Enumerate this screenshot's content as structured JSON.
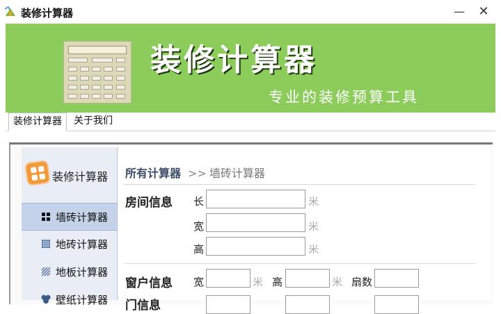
{
  "window": {
    "title": "装修计算器",
    "minimize_glyph": "—",
    "close_glyph": "✕"
  },
  "banner": {
    "title": "装修计算器",
    "subtitle": "专业的装修预算工具",
    "accent_color": "#8ccc5a"
  },
  "tabs": [
    {
      "label": "装修计算器",
      "active": true
    },
    {
      "label": "关于我们",
      "active": false
    }
  ],
  "sidebar": {
    "brand": "装修计算器",
    "items": [
      {
        "label": "墙砖计算器",
        "icon": "grid-icon",
        "selected": true
      },
      {
        "label": "地砖计算器",
        "icon": "checker-icon",
        "selected": false
      },
      {
        "label": "地板计算器",
        "icon": "stripes-icon",
        "selected": false
      },
      {
        "label": "壁纸计算器",
        "icon": "wallpaper-icon",
        "selected": false
      }
    ]
  },
  "breadcrumb": {
    "root": "所有计算器",
    "separator": ">>",
    "current": "墙砖计算器"
  },
  "room": {
    "title": "房间信息",
    "length_label": "长",
    "width_label": "宽",
    "height_label": "高",
    "unit": "米",
    "length_value": "",
    "width_value": "",
    "height_value": ""
  },
  "window_info": {
    "title": "窗户信息",
    "width_label": "宽",
    "height_label": "高",
    "count_label": "扇数",
    "unit": "米",
    "width_value": "",
    "height_value": "",
    "count_value": ""
  },
  "door_info": {
    "title": "门信息"
  }
}
